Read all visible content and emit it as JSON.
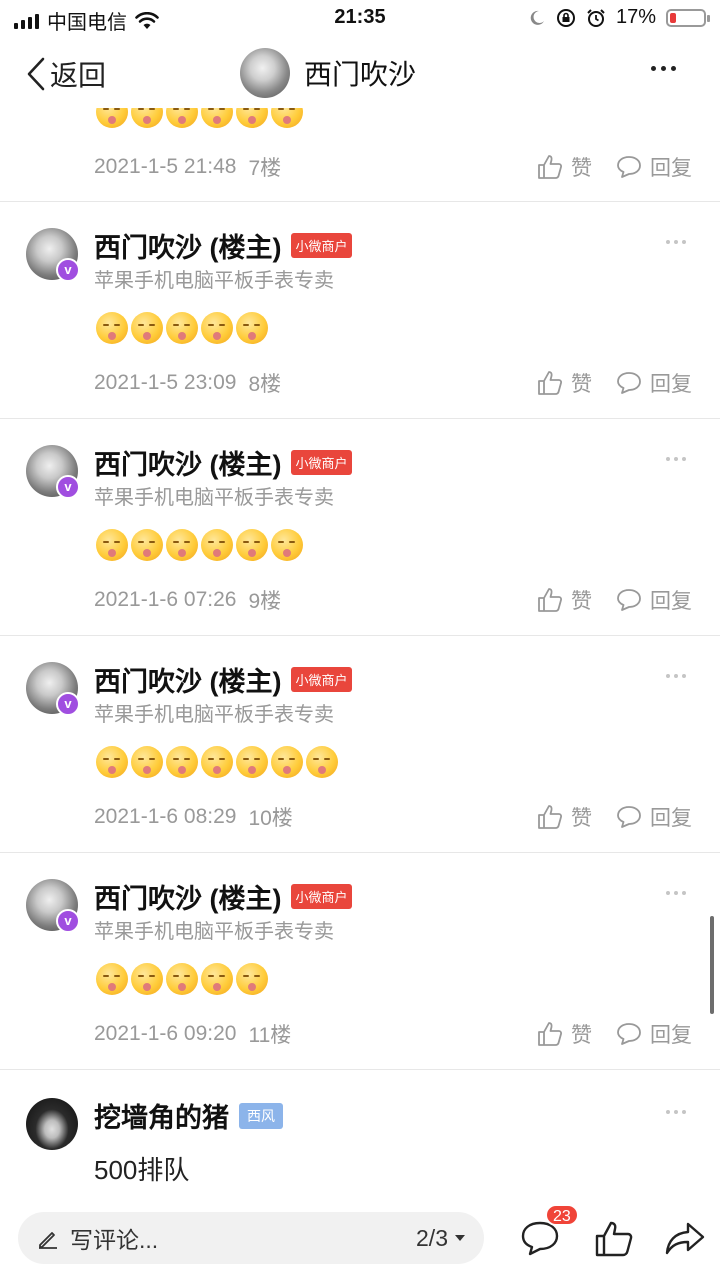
{
  "status_bar": {
    "carrier": "中国电信",
    "time": "21:35",
    "battery_pct": "17%",
    "icons": [
      "signal-icon",
      "wifi-icon",
      "moon-icon",
      "orientation-lock-icon",
      "alarm-icon",
      "battery-icon"
    ]
  },
  "nav": {
    "back_label": "返回",
    "title": "西门吹沙"
  },
  "top_partial": {
    "date": "2021-1-5 21:48",
    "floor": "7楼",
    "like_label": "赞",
    "reply_label": "回复"
  },
  "posts": [
    {
      "name": "西门吹沙 (楼主)",
      "tag": "小微商户",
      "subtitle": "苹果手机电脑平板手表专卖",
      "emoji_count": 5,
      "date": "2021-1-5 23:09",
      "floor": "8楼",
      "like_label": "赞",
      "reply_label": "回复"
    },
    {
      "name": "西门吹沙 (楼主)",
      "tag": "小微商户",
      "subtitle": "苹果手机电脑平板手表专卖",
      "emoji_count": 6,
      "date": "2021-1-6 07:26",
      "floor": "9楼",
      "like_label": "赞",
      "reply_label": "回复"
    },
    {
      "name": "西门吹沙 (楼主)",
      "tag": "小微商户",
      "subtitle": "苹果手机电脑平板手表专卖",
      "emoji_count": 7,
      "date": "2021-1-6 08:29",
      "floor": "10楼",
      "like_label": "赞",
      "reply_label": "回复"
    },
    {
      "name": "西门吹沙 (楼主)",
      "tag": "小微商户",
      "subtitle": "苹果手机电脑平板手表专卖",
      "emoji_count": 5,
      "date": "2021-1-6 09:20",
      "floor": "11楼",
      "like_label": "赞",
      "reply_label": "回复"
    }
  ],
  "last_comment": {
    "name": "挖墙角的猪",
    "tag": "西风",
    "text": "500排队"
  },
  "bottom_bar": {
    "comment_placeholder": "写评论...",
    "page_indicator": "2/3",
    "comment_count": "23"
  },
  "colors": {
    "tag_red": "#e9463c",
    "tag_blue": "#8cb4ea",
    "verified_purple": "#a04ee0",
    "badge_red": "#f04438",
    "meta_gray": "#999999"
  }
}
